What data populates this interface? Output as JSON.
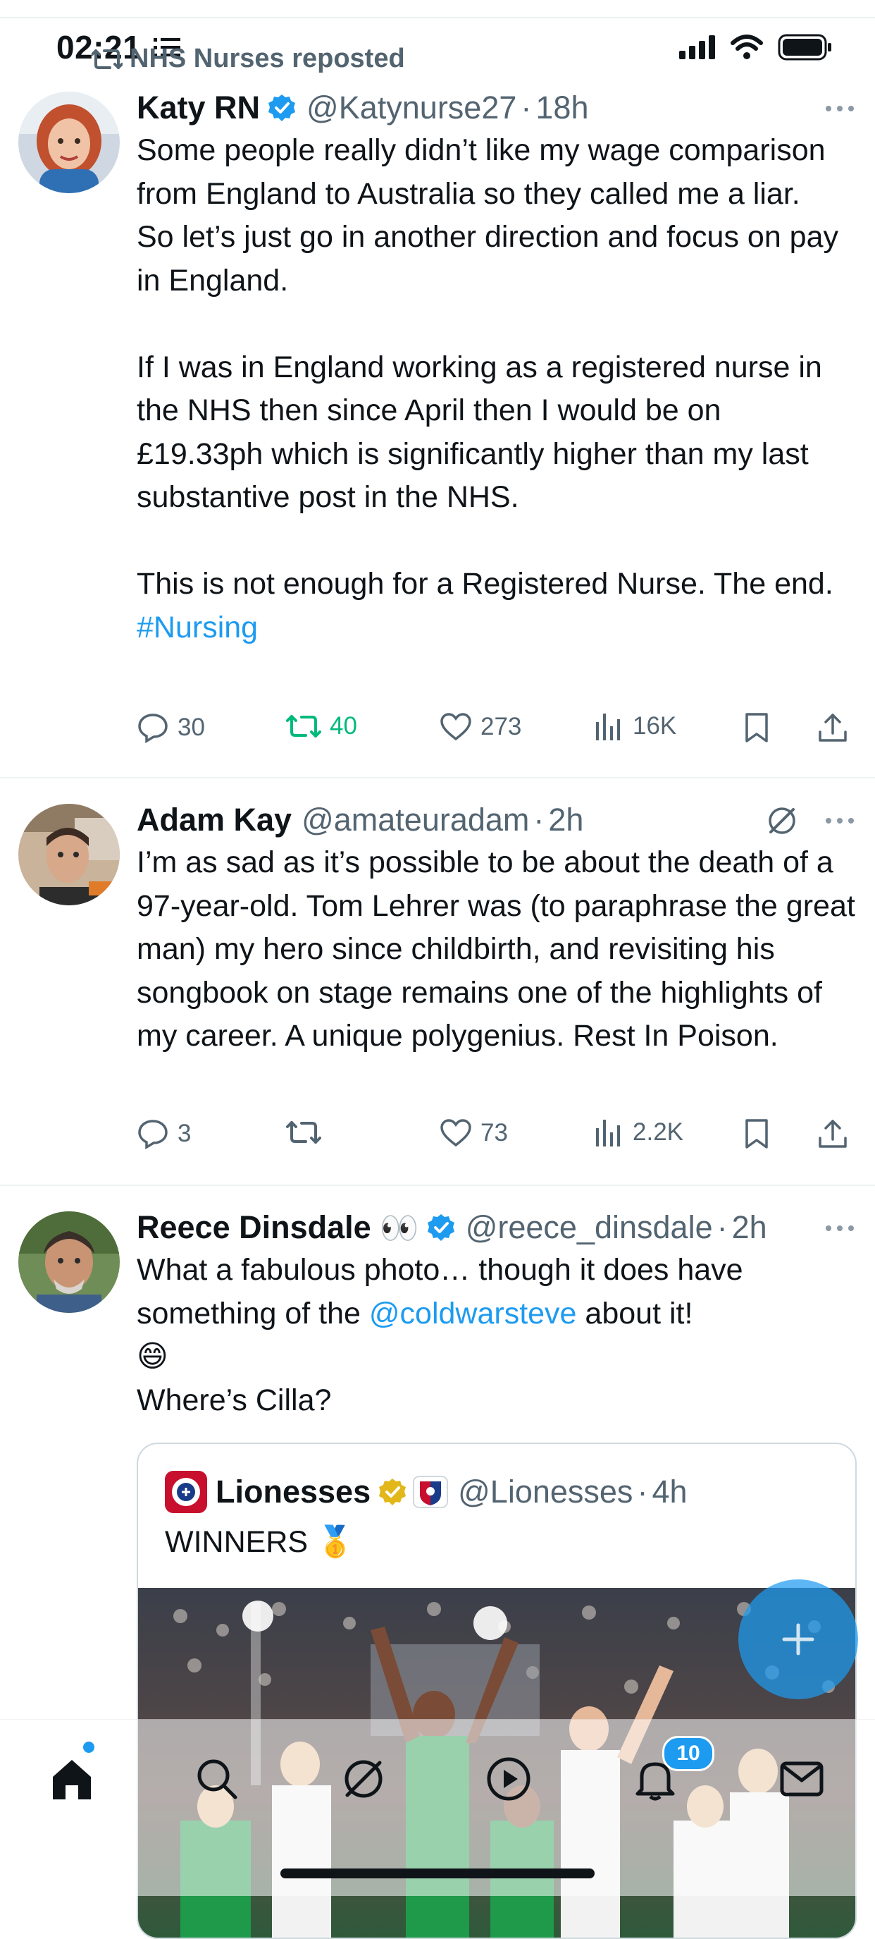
{
  "status_bar": {
    "time": "02:21"
  },
  "repost_banner": {
    "text": "NHS Nurses reposted"
  },
  "posts": [
    {
      "name": "Katy RN",
      "handle": "@Katynurse27",
      "time": "18h",
      "verified": true,
      "text": "Some people really didn’t like my wage comparison from England to Australia so they called me a liar.\nSo let’s just go in another direction and focus on pay in England.\n\nIf I was in England working as a registered nurse in the NHS then since April then I would be on £19.33ph which is significantly higher than my last substantive post in the NHS.\n\nThis is not enough for a Registered Nurse. The end. ",
      "hashtag": "#Nursing",
      "replies": "30",
      "reposts": "40",
      "likes": "273",
      "views": "16K"
    },
    {
      "name": "Adam Kay",
      "handle": "@amateuradam",
      "time": "2h",
      "text": "I’m as sad as it’s possible to be about the death of a 97-year-old. Tom Lehrer was (to paraphrase the great man) my hero since childbirth, and revisiting his songbook on stage remains one of the highlights of my career. A unique polygenius. Rest In Poison.",
      "replies": "3",
      "reposts": "",
      "likes": "73",
      "views": "2.2K"
    },
    {
      "name": "Reece Dinsdale",
      "name_emoji": "👀",
      "handle": "@reece_dinsdale",
      "time": "2h",
      "verified": true,
      "text_before": "What a fabulous photo… though it does have something of the ",
      "mention": "@coldwarsteve",
      "text_after": " about it!\n😄\nWhere’s Cilla?",
      "quote": {
        "name": "Lionesses",
        "handle": "@Lionesses",
        "time": "4h",
        "text": "WINNERS 🥇"
      }
    }
  ],
  "tab_bar": {
    "tabs": [
      "home-tab",
      "search-tab",
      "grok-tab",
      "video-tab",
      "notifications-tab",
      "messages-tab"
    ],
    "notification_count": "10"
  },
  "colors": {
    "accent": "#1d9bf0",
    "repost_green": "#00ba7c",
    "secondary_text": "#536471"
  }
}
